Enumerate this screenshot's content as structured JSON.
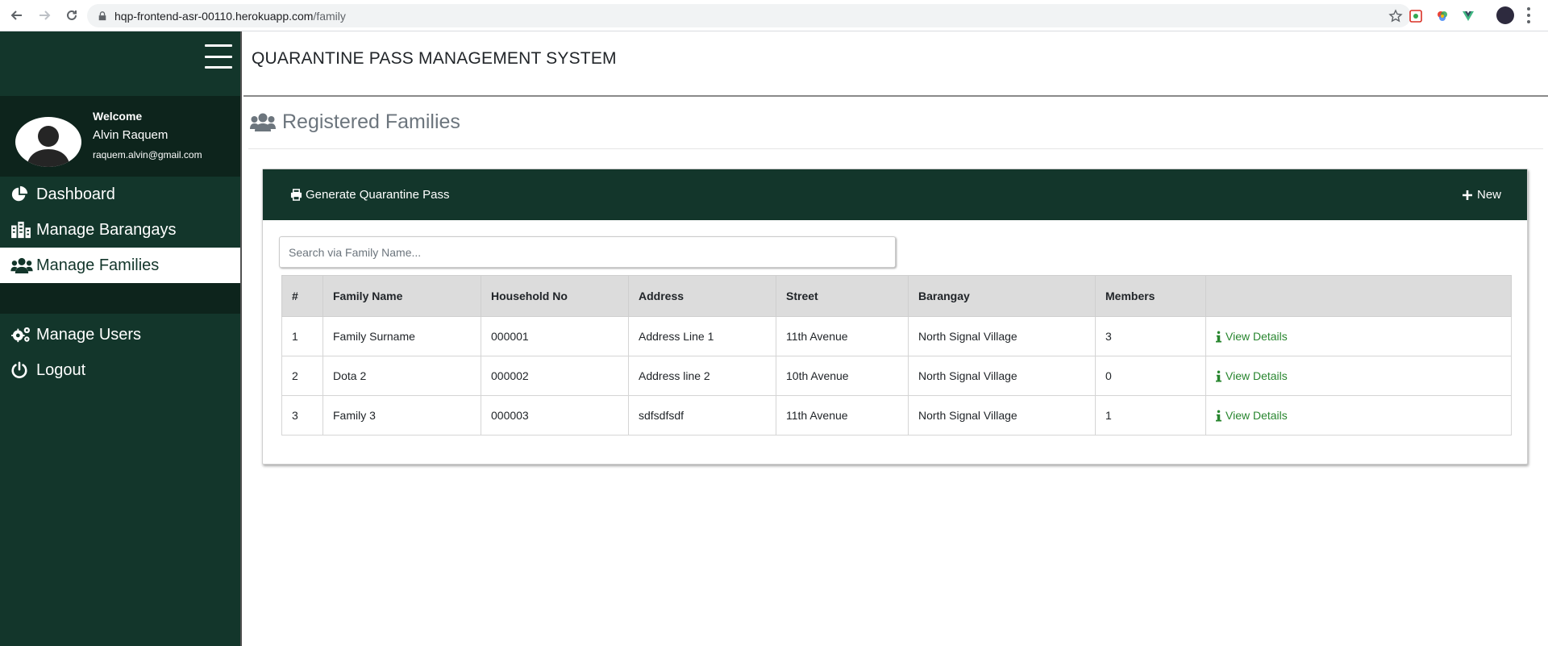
{
  "browser": {
    "url_host": "hqp-frontend-asr-00110.herokuapp.com",
    "url_path": "/family"
  },
  "app": {
    "title": "QUARANTINE PASS MANAGEMENT SYSTEM"
  },
  "user": {
    "welcome": "Welcome",
    "name": "Alvin Raquem",
    "email": "raquem.alvin@gmail.com"
  },
  "sidebar": {
    "items": [
      {
        "label": "Dashboard",
        "icon": "chart-pie-icon"
      },
      {
        "label": "Manage Barangays",
        "icon": "building-icon"
      },
      {
        "label": "Manage Families",
        "icon": "users-icon",
        "active": true
      },
      {
        "label": "Manage Users",
        "icon": "cogs-icon"
      },
      {
        "label": "Logout",
        "icon": "power-icon"
      }
    ]
  },
  "page": {
    "title": "Registered Families",
    "generate_label": "Generate Quarantine Pass",
    "new_label": "New",
    "search_placeholder": "Search via Family Name..."
  },
  "table": {
    "headers": [
      "#",
      "Family Name",
      "Household No",
      "Address",
      "Street",
      "Barangay",
      "Members",
      ""
    ],
    "rows": [
      {
        "num": "1",
        "family": "Family Surname",
        "household": "000001",
        "address": "Address Line 1",
        "street": "11th Avenue",
        "barangay": "North Signal Village",
        "members": "3",
        "action": "View Details"
      },
      {
        "num": "2",
        "family": "Dota 2",
        "household": "000002",
        "address": "Address line 2",
        "street": "10th Avenue",
        "barangay": "North Signal Village",
        "members": "0",
        "action": "View Details"
      },
      {
        "num": "3",
        "family": "Family 3",
        "household": "000003",
        "address": "sdfsdfsdf",
        "street": "11th Avenue",
        "barangay": "North Signal Village",
        "members": "1",
        "action": "View Details"
      }
    ]
  },
  "colors": {
    "sidebar": "#13362b",
    "sidebar_dark": "#0d241c",
    "link": "#28862f"
  }
}
